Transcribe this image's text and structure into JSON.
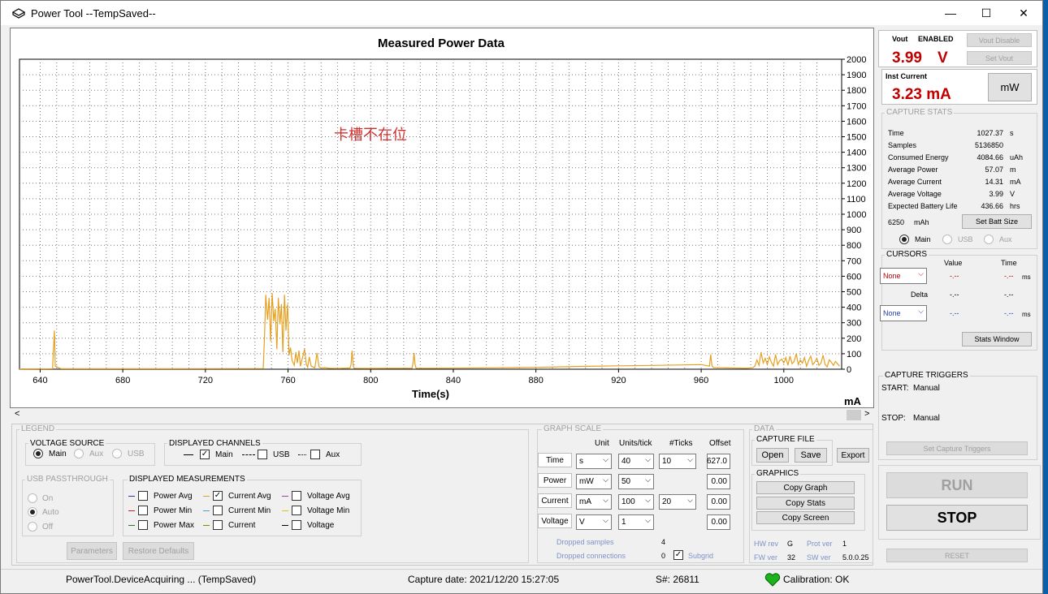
{
  "window": {
    "title": "Power Tool --TempSaved--",
    "minimize": "—",
    "maximize": "☐",
    "close": "✕"
  },
  "chart_data": {
    "type": "line",
    "title": "Measured Power Data",
    "xlabel": "Time(s)",
    "ylabel": "mA",
    "annotation": "卡槽不在位",
    "xlim": [
      630,
      1028
    ],
    "ylim": [
      0,
      2000
    ],
    "x_ticks": [
      640,
      680,
      720,
      760,
      800,
      840,
      880,
      920,
      960,
      1000
    ],
    "y_ticks": [
      0,
      100,
      200,
      300,
      400,
      500,
      600,
      700,
      800,
      900,
      1000,
      1100,
      1200,
      1300,
      1400,
      1500,
      1600,
      1700,
      1800,
      1900,
      2000
    ],
    "grid": true,
    "series": [
      {
        "color": "#e6a020",
        "x": [
          630,
          646,
          646.4,
          646.9,
          647.3,
          650,
          700,
          748,
          748.6,
          749.2,
          750.1,
          750.8,
          751.6,
          752.3,
          753.1,
          753.8,
          754.6,
          755.3,
          756.1,
          756.8,
          757.5,
          758.3,
          759,
          759.8,
          760.5,
          761.2,
          762,
          763,
          763.8,
          764.5,
          765.3,
          766,
          767,
          768,
          768.8,
          769.5,
          770.3,
          771.2,
          772,
          773,
          774,
          775,
          776,
          778,
          780,
          785,
          790,
          790.5,
          791,
          791.6,
          792,
          800,
          810,
          820,
          820.5,
          821,
          821.5,
          822,
          830,
          840,
          860,
          880,
          900,
          920,
          940,
          960,
          964,
          964.6,
          965.2,
          966,
          975,
          982,
          985,
          986,
          987,
          988,
          989,
          990,
          991,
          992,
          993,
          994,
          995,
          996,
          997,
          998,
          999,
          1000,
          1001,
          1002,
          1003,
          1004,
          1005,
          1006,
          1007,
          1008,
          1009,
          1010,
          1011,
          1012,
          1013,
          1014,
          1015,
          1016,
          1017,
          1018,
          1019,
          1020,
          1021,
          1022,
          1023,
          1024,
          1025,
          1026,
          1027
        ],
        "y": [
          2,
          3,
          120,
          250,
          20,
          3,
          3,
          4,
          210,
          480,
          320,
          460,
          180,
          490,
          310,
          390,
          130,
          460,
          290,
          420,
          110,
          480,
          250,
          420,
          90,
          140,
          55,
          25,
          110,
          40,
          120,
          20,
          75,
          130,
          35,
          12,
          80,
          20,
          15,
          10,
          105,
          15,
          8,
          10,
          6,
          5,
          8,
          30,
          120,
          20,
          6,
          5,
          6,
          6,
          40,
          105,
          30,
          6,
          6,
          7,
          9,
          12,
          18,
          22,
          25,
          30,
          20,
          95,
          22,
          10,
          8,
          6,
          10,
          20,
          60,
          25,
          110,
          40,
          70,
          30,
          80,
          45,
          20,
          95,
          30,
          55,
          65,
          40,
          75,
          25,
          85,
          35,
          50,
          100,
          30,
          60,
          40,
          75,
          20,
          55,
          85,
          30,
          45,
          70,
          25,
          40,
          90,
          30,
          15,
          60,
          45,
          25,
          50,
          35,
          20
        ]
      }
    ]
  },
  "bottom_unit": "mA",
  "vout": {
    "label": "Vout",
    "state": "ENABLED",
    "value": "3.99",
    "unit": "V",
    "disable_btn": "Vout Disable",
    "set_btn": "Set Vout"
  },
  "inst": {
    "label": "Inst Current",
    "value": "3.23 mA",
    "unit_btn": "mW"
  },
  "capture_stats": {
    "title": "CAPTURE STATS",
    "rows": [
      {
        "name": "Time",
        "value": "1027.37",
        "unit": "s"
      },
      {
        "name": "Samples",
        "value": "5136850",
        "unit": ""
      },
      {
        "name": "Consumed Energy",
        "value": "4084.66",
        "unit": "uAh"
      },
      {
        "name": "Average Power",
        "value": "57.07",
        "unit": "m"
      },
      {
        "name": "Average Current",
        "value": "14.31",
        "unit": "mA"
      },
      {
        "name": "Average Voltage",
        "value": "3.99",
        "unit": "V"
      },
      {
        "name": "Expected Battery Life",
        "value": "436.66",
        "unit": "hrs"
      }
    ],
    "batt": "6250",
    "batt_unit": "mAh",
    "set_batt_btn": "Set Batt Size",
    "radio_main": "Main",
    "radio_usb": "USB",
    "radio_aux": "Aux"
  },
  "cursors": {
    "title": "CURSORS",
    "col_value": "Value",
    "col_time": "Time",
    "delta": "Delta",
    "sel1": "None",
    "sel2": "None",
    "dash": "-.--",
    "ms": "ms",
    "stats_window_btn": "Stats Window"
  },
  "triggers": {
    "title": "CAPTURE TRIGGERS",
    "start_lbl": "START:",
    "start_val": "Manual",
    "stop_lbl": "STOP:",
    "stop_val": "Manual",
    "set_btn": "Set Capture Triggers"
  },
  "run_btn": "RUN",
  "stop_btn": "STOP",
  "reset_btn": "RESET",
  "legend": {
    "title": "LEGEND",
    "voltage_source": {
      "title": "VOLTAGE SOURCE",
      "main": "Main",
      "aux": "Aux",
      "usb": "USB"
    },
    "channels": {
      "title": "DISPLAYED CHANNELS",
      "main": "Main",
      "usb": "USB",
      "aux": "Aux"
    },
    "passthrough": {
      "title": "USB PASSTHROUGH",
      "on": "On",
      "auto": "Auto",
      "off": "Off"
    },
    "measurements": {
      "title": "DISPLAYED MEASUREMENTS",
      "items": [
        "Power Avg",
        "Power Min",
        "Power Max",
        "Current Avg",
        "Current Min",
        "Current",
        "Voltage Avg",
        "Voltage Min",
        "Voltage"
      ]
    },
    "parameters_btn": "Parameters",
    "restore_btn": "Restore Defaults"
  },
  "graph_scale": {
    "title": "GRAPH SCALE",
    "col_unit": "Unit",
    "col_units_tick": "Units/tick",
    "col_ticks": "#Ticks",
    "col_offset": "Offset",
    "rows": [
      {
        "name": "Time",
        "unit": "s",
        "per": "40",
        "ticks": "10",
        "offset": "627.0"
      },
      {
        "name": "Power",
        "unit": "mW",
        "per": "50",
        "ticks": "",
        "offset": "0.00"
      },
      {
        "name": "Current",
        "unit": "mA",
        "per": "100",
        "ticks": "20",
        "offset": "0.00"
      },
      {
        "name": "Voltage",
        "unit": "V",
        "per": "1",
        "ticks": "",
        "offset": "0.00"
      }
    ],
    "dropped_samples": "Dropped samples",
    "dropped_samples_val": "4",
    "dropped_conn": "Dropped connections",
    "dropped_conn_val": "0",
    "subgrid": "Subgrid"
  },
  "data_panel": {
    "title": "DATA",
    "capture_file": "CAPTURE FILE",
    "open": "Open",
    "save": "Save",
    "export": "Export",
    "graphics": "GRAPHICS",
    "copy_graph": "Copy Graph",
    "copy_stats": "Copy Stats",
    "copy_screen": "Copy Screen",
    "hw_rev": "HW rev",
    "hw_rev_val": "G",
    "prot_ver": "Prot ver",
    "prot_ver_val": "1",
    "fw_ver": "FW ver",
    "fw_ver_val": "32",
    "sw_ver": "SW ver",
    "sw_ver_val": "5.0.0.25"
  },
  "status": {
    "left": "PowerTool.DeviceAcquiring ... (TempSaved)",
    "capture": "Capture date: 2021/12/20 15:27:05",
    "serial": "S#: 26811",
    "calibration": "Calibration: OK"
  }
}
